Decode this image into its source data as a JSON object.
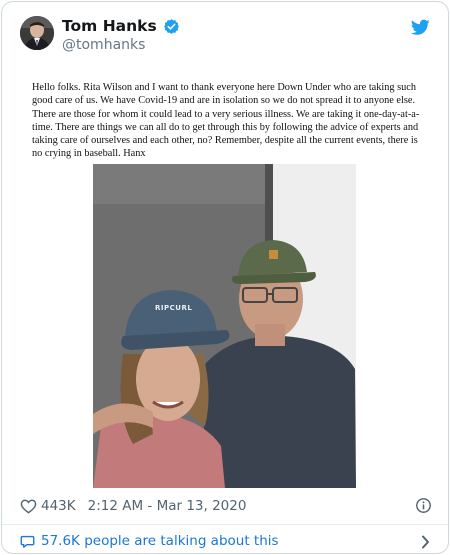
{
  "author": {
    "display_name": "Tom Hanks",
    "handle": "@tomhanks"
  },
  "tweet": {
    "text": "Hello folks. Rita Wilson and I want to thank everyone here Down Under who are taking such good care of us. We have Covid-19 and are in isolation so we do not spread it to anyone else. There are those for whom it could lead to a very serious illness. We are taking it one-day-at-a-time. There are things we can all do to get through this by following the advice of experts and taking care of ourselves and each other, no? Remember, despite all the current events, there is no crying in baseball. Hanx",
    "photo_cap_text": "RIPCURL"
  },
  "meta": {
    "like_count": "443K",
    "timestamp": "2:12 AM - Mar 13, 2020"
  },
  "footer": {
    "talking_text": "57.6K people are talking about this"
  },
  "colors": {
    "accent_blue": "#1da1f2",
    "link_blue": "#1b76d6",
    "muted_gray": "#536471"
  },
  "icons": {
    "verified": "verified-badge-icon",
    "brand": "twitter-bird-icon",
    "like": "heart-outline-icon",
    "info": "info-circle-icon",
    "talk": "speech-bubble-icon",
    "more": "chevron-right-icon"
  }
}
